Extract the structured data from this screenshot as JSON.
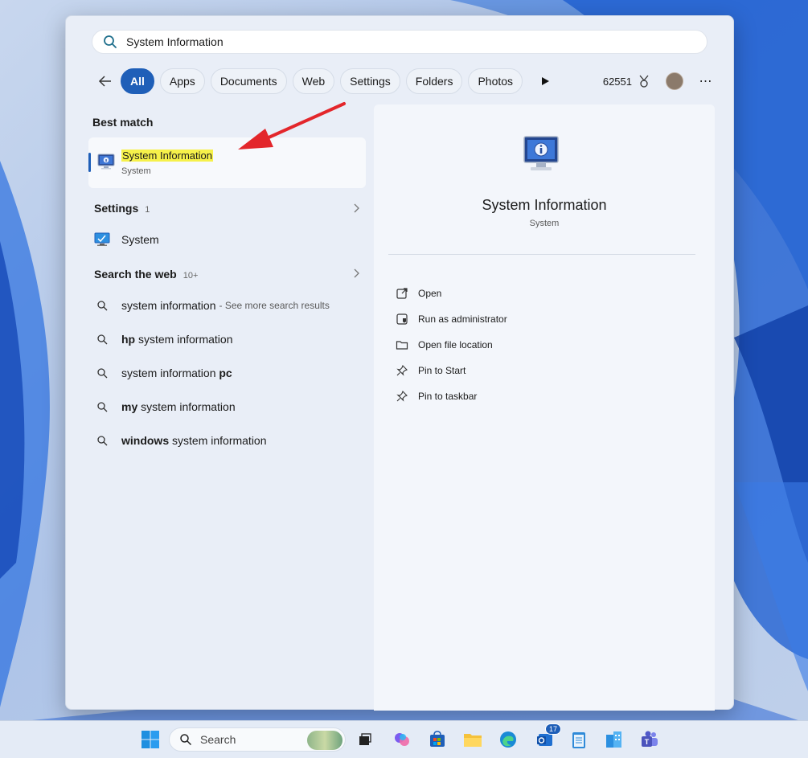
{
  "search": {
    "query": "System Information"
  },
  "filters": {
    "chips": [
      "All",
      "Apps",
      "Documents",
      "Web",
      "Settings",
      "Folders",
      "Photos"
    ],
    "active": "All",
    "points": "62551"
  },
  "best_match": {
    "heading": "Best match",
    "title": "System Information",
    "subtitle": "System"
  },
  "settings_section": {
    "heading": "Settings",
    "count": "1",
    "items": [
      {
        "label": "System"
      }
    ]
  },
  "web_section": {
    "heading": "Search the web",
    "count": "10+",
    "items": [
      {
        "bold": "",
        "text": "system information",
        "extra": "- See more search results"
      },
      {
        "bold": "hp",
        "text": " system information",
        "extra": ""
      },
      {
        "bold": "",
        "text": "system information ",
        "tail_bold": "pc",
        "extra": ""
      },
      {
        "bold": "my",
        "text": " system information",
        "extra": ""
      },
      {
        "bold": "windows",
        "text": " system information",
        "extra": ""
      }
    ]
  },
  "detail": {
    "title": "System Information",
    "subtitle": "System",
    "actions": [
      {
        "label": "Open",
        "icon": "open-external-icon"
      },
      {
        "label": "Run as administrator",
        "icon": "shield-icon"
      },
      {
        "label": "Open file location",
        "icon": "folder-icon"
      },
      {
        "label": "Pin to Start",
        "icon": "pin-icon"
      },
      {
        "label": "Pin to taskbar",
        "icon": "pin-icon"
      }
    ]
  },
  "taskbar": {
    "search_label": "Search",
    "mail_badge": "17"
  },
  "colors": {
    "accent": "#1f5fb8",
    "highlight": "#f6f14a",
    "annotation_arrow": "#e3262b"
  }
}
